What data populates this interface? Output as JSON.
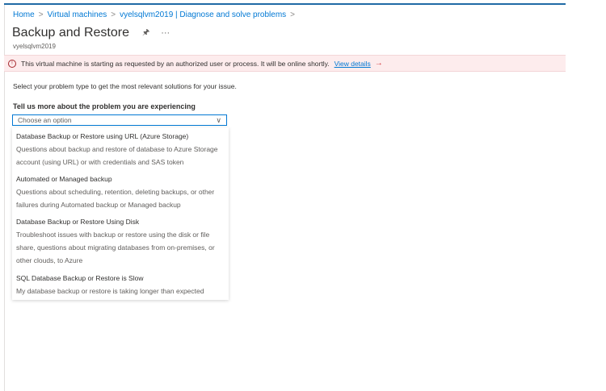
{
  "breadcrumb": [
    "Home",
    "Virtual machines",
    "vyelsqlvm2019 | Diagnose and solve problems"
  ],
  "header": {
    "title": "Backup and Restore",
    "subtitle": "vyelsqlvm2019",
    "pin_icon": "pin-icon",
    "more_icon": "more-icon"
  },
  "banner": {
    "message": "This virtual machine is starting as requested by an authorized user or process. It will be online shortly.",
    "link": "View details",
    "arrow": "→",
    "icon": "!"
  },
  "intro": "Select your problem type to get the most relevant solutions for your issue.",
  "question": "Tell us more about the problem you are experiencing",
  "select": {
    "placeholder": "Choose an option"
  },
  "options": [
    {
      "title": "Database Backup or Restore using URL (Azure Storage)",
      "desc": "Questions about backup and restore of database to Azure Storage account (using URL) or with credentials and SAS token"
    },
    {
      "title": "Automated or Managed backup",
      "desc": "Questions about scheduling, retention, deleting backups, or other failures during Automated backup or Managed backup"
    },
    {
      "title": "Database Backup or Restore Using Disk",
      "desc": "Troubleshoot issues with backup or restore using the disk or file share, questions about migrating databases from on-premises, or other clouds, to Azure"
    },
    {
      "title": "SQL Database Backup or Restore is Slow",
      "desc": "My database backup or restore is taking longer than expected"
    }
  ]
}
